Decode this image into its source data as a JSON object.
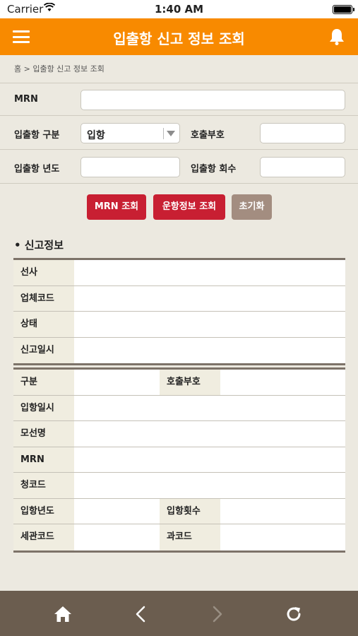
{
  "status_bar": {
    "carrier": "Carrier",
    "time": "1:40 AM"
  },
  "header": {
    "title": "입출항 신고 정보 조회",
    "menu_icon": "menu-icon",
    "bell_icon": "bell-icon"
  },
  "breadcrumb": "홈 > 입출항 신고 정보 조회",
  "form": {
    "mrn_label": "MRN",
    "mrn_value": "",
    "type_label": "입출항 구분",
    "type_selected": "입항",
    "call_sign_label": "호출부호",
    "call_sign_value": "",
    "year_label": "입출항 년도",
    "year_value": "",
    "count_label": "입출항 회수",
    "count_value": ""
  },
  "buttons": {
    "mrn_search": "MRN 조회",
    "voyage_search": "운항정보 조회",
    "reset": "초기화"
  },
  "section_title": "• 신고정보",
  "table1": [
    {
      "label": "선사",
      "value": ""
    },
    {
      "label": "업체코드",
      "value": ""
    },
    {
      "label": "상태",
      "value": ""
    },
    {
      "label": "신고일시",
      "value": ""
    }
  ],
  "table2": {
    "type_label": "구분",
    "type_value": "",
    "call_sign_label": "호출부호",
    "call_sign_value": "",
    "entry_datetime_label": "입항일시",
    "entry_datetime_value": "",
    "ship_name_label": "모선명",
    "ship_name_value": "",
    "mrn_label": "MRN",
    "mrn_value": "",
    "office_code_label": "청코드",
    "office_code_value": "",
    "entry_year_label": "입항년도",
    "entry_year_value": "",
    "entry_count_label": "입항횟수",
    "entry_count_value": "",
    "customs_code_label": "세관코드",
    "customs_code_value": "",
    "division_code_label": "과코드",
    "division_code_value": ""
  },
  "bottom_nav": {
    "home_icon": "home-icon",
    "back_icon": "chevron-left-icon",
    "forward_icon": "chevron-right-icon",
    "refresh_icon": "refresh-icon"
  },
  "colors": {
    "header": "#f88a00",
    "primary_button": "#c81f32",
    "secondary_button": "#a38d80",
    "bottom_nav": "#6b5d4f",
    "background": "#ece9e0"
  }
}
